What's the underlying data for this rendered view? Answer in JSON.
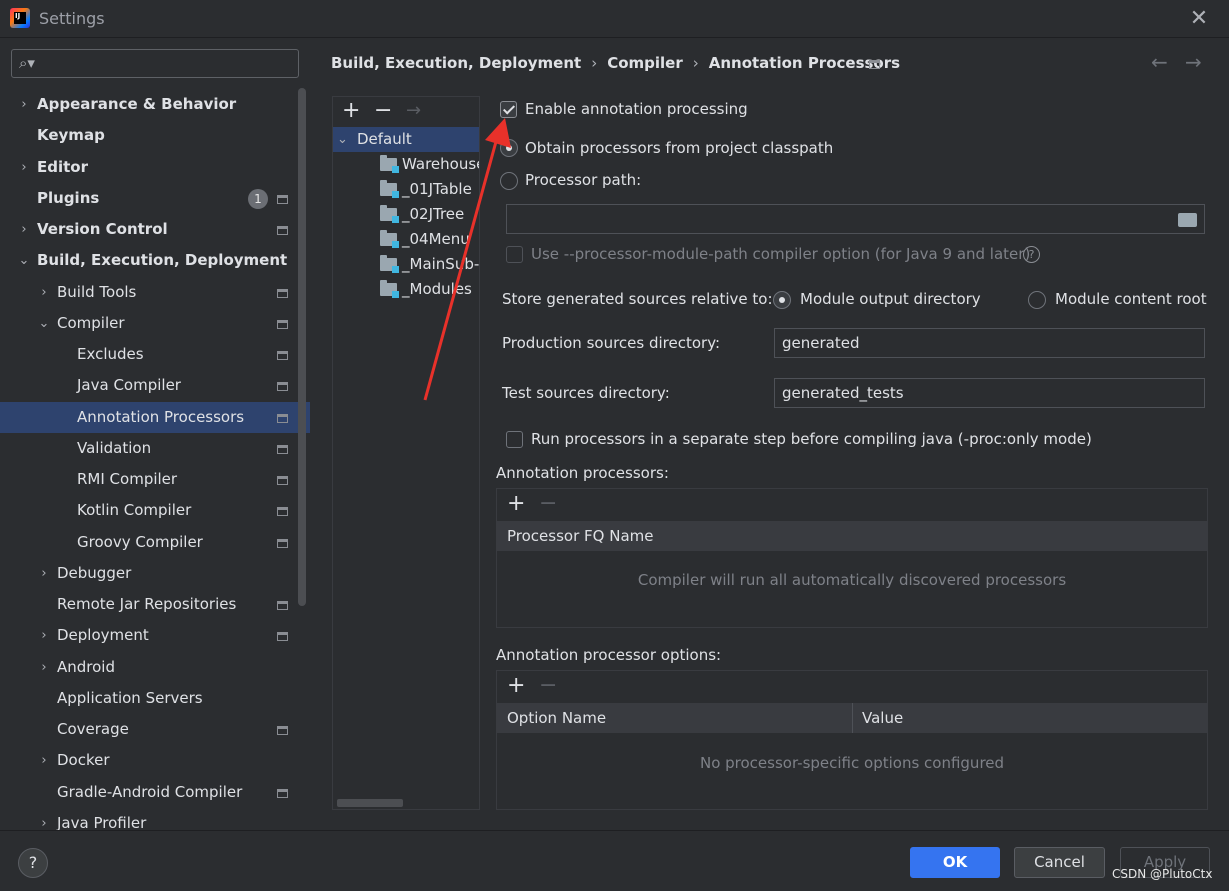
{
  "window": {
    "title": "Settings",
    "close": "✕"
  },
  "search": {
    "placeholder": ""
  },
  "sidebar": {
    "badge_count": "1",
    "items": [
      {
        "label": "Appearance & Behavior",
        "bold": true,
        "chevron": "›"
      },
      {
        "label": "Keymap",
        "bold": true
      },
      {
        "label": "Editor",
        "bold": true,
        "chevron": "›"
      },
      {
        "label": "Plugins",
        "bold": true
      },
      {
        "label": "Version Control",
        "bold": true,
        "chevron": "›"
      },
      {
        "label": "Build, Execution, Deployment",
        "bold": true,
        "chevron": "⌄"
      },
      {
        "label": "Build Tools",
        "chevron": "›"
      },
      {
        "label": "Compiler",
        "chevron": "⌄"
      },
      {
        "label": "Excludes"
      },
      {
        "label": "Java Compiler"
      },
      {
        "label": "Annotation Processors",
        "selected": true
      },
      {
        "label": "Validation"
      },
      {
        "label": "RMI Compiler"
      },
      {
        "label": "Kotlin Compiler"
      },
      {
        "label": "Groovy Compiler"
      },
      {
        "label": "Debugger",
        "chevron": "›"
      },
      {
        "label": "Remote Jar Repositories"
      },
      {
        "label": "Deployment",
        "chevron": "›"
      },
      {
        "label": "Android",
        "chevron": "›"
      },
      {
        "label": "Application Servers"
      },
      {
        "label": "Coverage"
      },
      {
        "label": "Docker",
        "chevron": "›"
      },
      {
        "label": "Gradle-Android Compiler"
      },
      {
        "label": "Java Profiler",
        "chevron": "›"
      }
    ]
  },
  "breadcrumb": {
    "part1": "Build, Execution, Deployment",
    "part2": "Compiler",
    "part3": "Annotation Processors",
    "sep": "›",
    "back": "←",
    "forward": "→"
  },
  "profiles": {
    "add": "+",
    "remove": "−",
    "move": "→",
    "root": "Default",
    "root_chevron": "⌄",
    "modules": [
      "Warehouse",
      "_01JTable",
      "_02JTree",
      "_04Menu",
      "_MainSub-",
      "_Modules"
    ]
  },
  "form": {
    "enable_label": "Enable annotation processing",
    "obtain_label": "Obtain processors from project classpath",
    "processor_path_label": "Processor path:",
    "processor_path_value": "",
    "module_path_label": "Use --processor-module-path compiler option (for Java 9 and later)",
    "help": "?",
    "store_label": "Store generated sources relative to:",
    "module_output_label": "Module output directory",
    "module_content_label": "Module content root",
    "prod_dir_label": "Production sources directory:",
    "prod_dir_value": "generated",
    "test_dir_label": "Test sources directory:",
    "test_dir_value": "generated_tests",
    "separate_step_label": "Run processors in a separate step before compiling java (-proc:only mode)"
  },
  "processors_table": {
    "title": "Annotation processors:",
    "add": "+",
    "remove": "−",
    "col_name": "Processor FQ Name",
    "empty": "Compiler will run all automatically discovered processors"
  },
  "options_table": {
    "title": "Annotation processor options:",
    "add": "+",
    "remove": "−",
    "col_option": "Option Name",
    "col_value": "Value",
    "empty": "No processor-specific options configured"
  },
  "buttons": {
    "help": "?",
    "ok": "OK",
    "cancel": "Cancel",
    "apply": "Apply"
  },
  "watermark": "CSDN @PlutoCtx",
  "colors": {
    "accent": "#3574f0",
    "selection": "#2e436e",
    "arrow": "#e8312a",
    "background": "#2b2d30"
  }
}
